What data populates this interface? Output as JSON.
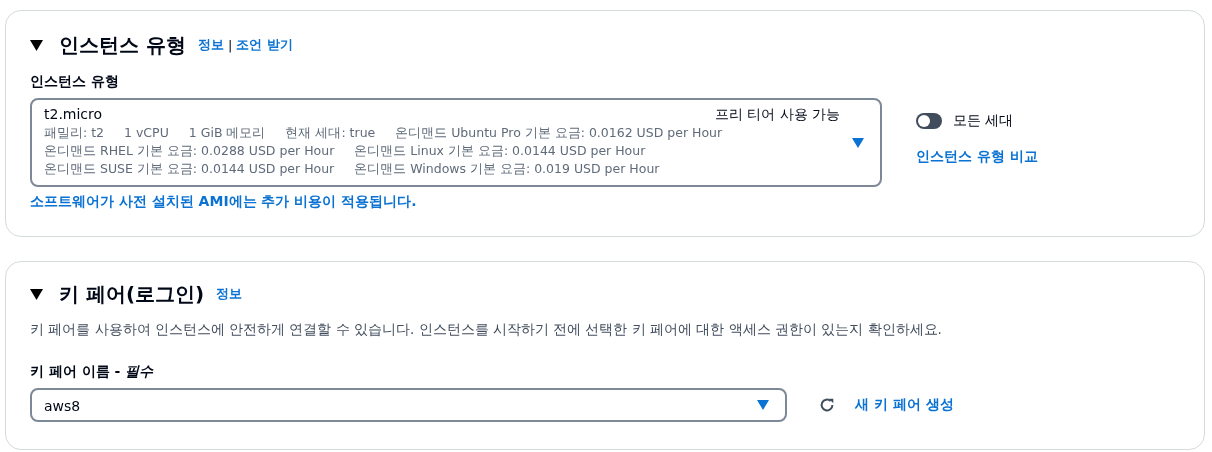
{
  "instance_type_section": {
    "title": "인스턴스 유형",
    "expanded": true,
    "info_link": "정보",
    "separator": "|",
    "advice_link": "조언 받기",
    "field_label": "인스턴스 유형",
    "select": {
      "value": "t2.micro",
      "badge": "프리 티어 사용 가능",
      "details": [
        [
          "패밀리: t2",
          "1 vCPU",
          "1 GiB 메모리",
          "현재 세대: true",
          "온디맨드 Ubuntu Pro 기본 요금: 0.0162 USD per Hour"
        ],
        [
          "온디맨드 RHEL 기본 요금: 0.0288 USD per Hour",
          "온디맨드 Linux 기본 요금: 0.0144 USD per Hour"
        ],
        [
          "온디맨드 SUSE 기본 요금: 0.0144 USD per Hour",
          "온디맨드 Windows 기본 요금: 0.019 USD per Hour"
        ]
      ]
    },
    "note": "소프트웨어가 사전 설치된 AMI에는 추가 비용이 적용됩니다.",
    "toggle": {
      "label": "모든 세대",
      "on": false
    },
    "compare_link": "인스턴스 유형 비교"
  },
  "key_pair_section": {
    "title": "키 페어(로그인)",
    "expanded": true,
    "info_link": "정보",
    "description": "키 페어를 사용하여 인스턴스에 안전하게 연결할 수 있습니다. 인스턴스를 시작하기 전에 선택한 키 페어에 대한 액세스 권한이 있는지 확인하세요.",
    "field_label": "키 페어 이름 - *필수*",
    "select": {
      "value": "aws8"
    },
    "create_link": "새 키 페어 생성"
  }
}
